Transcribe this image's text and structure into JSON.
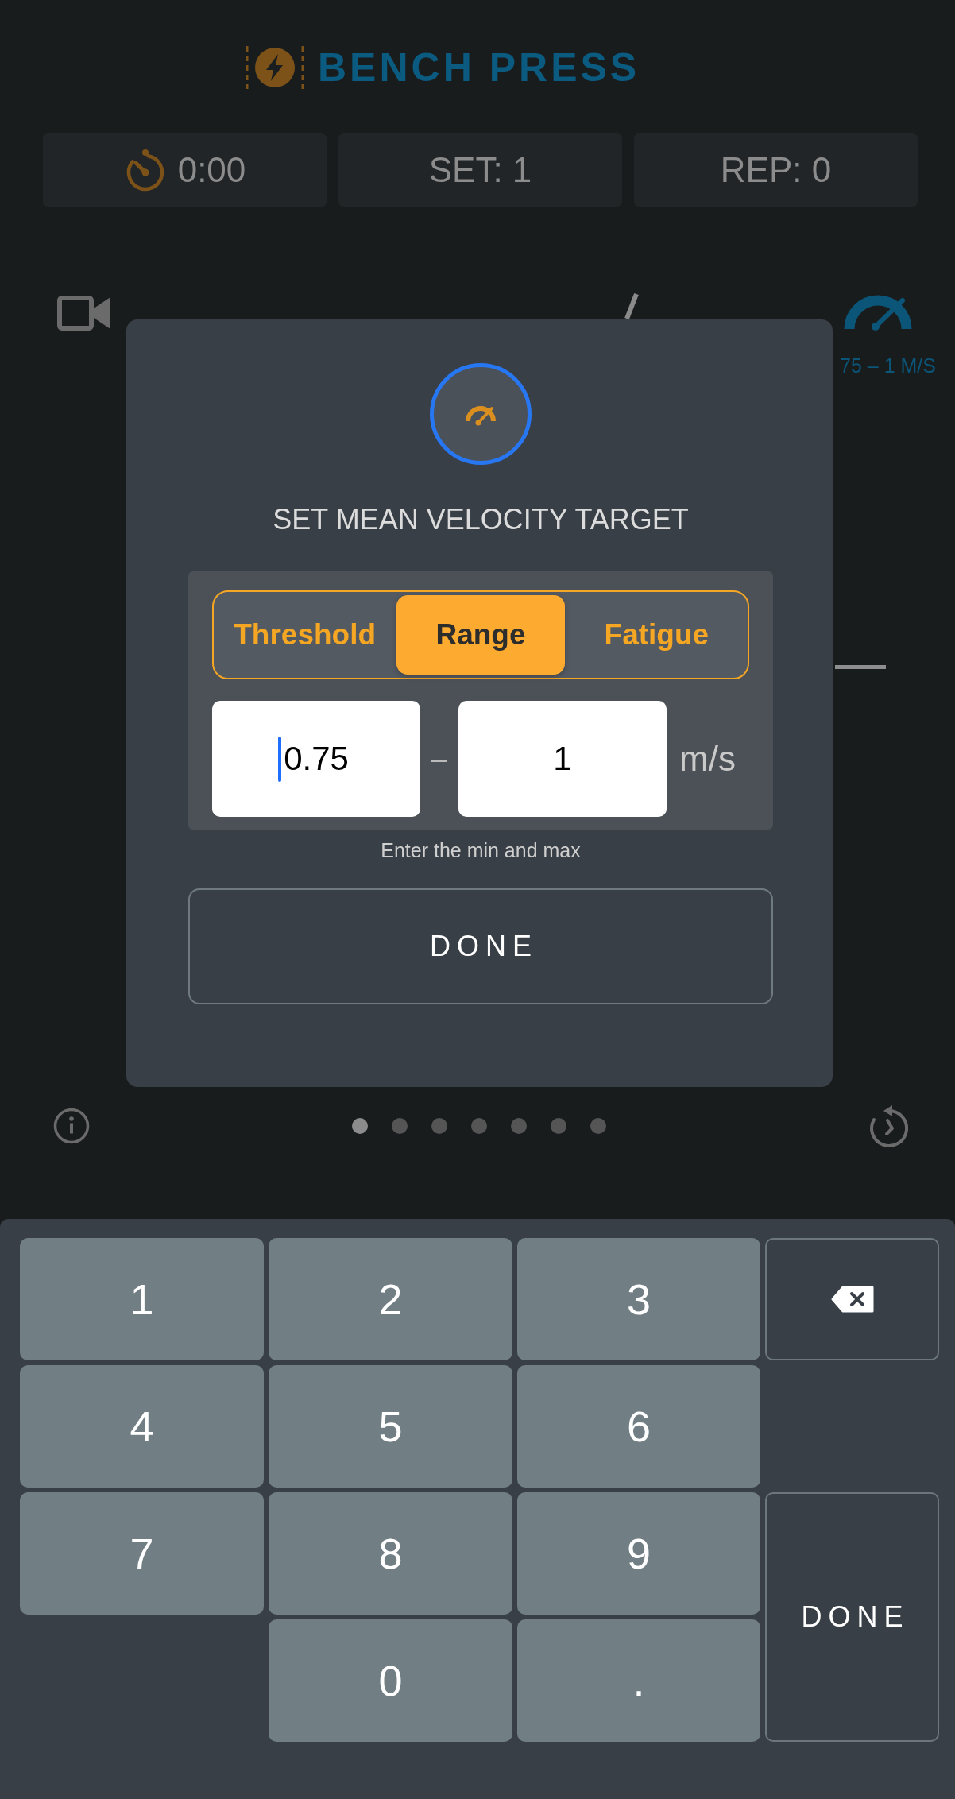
{
  "header": {
    "title": "BENCH PRESS",
    "stats": [
      {
        "kind": "timer",
        "text": "0:00"
      },
      {
        "kind": "counter",
        "text": "SET: 1"
      },
      {
        "kind": "counter",
        "text": "REP: 0"
      }
    ]
  },
  "workout": {
    "velocity_target": "75 – 1 M/S"
  },
  "dialog": {
    "title": "SET MEAN VELOCITY TARGET",
    "modes": [
      {
        "label": "Threshold",
        "selected": false
      },
      {
        "label": "Range",
        "selected": true
      },
      {
        "label": "Fatigue",
        "selected": false
      }
    ],
    "fields": [
      {
        "value": "0.75",
        "focused": true
      },
      {
        "value": "1",
        "focused": false
      }
    ],
    "separator": "–",
    "unit": "m/s",
    "hint": "Enter the min and max",
    "button": "DONE"
  },
  "pager": {
    "dots": [
      {
        "selected": true
      },
      {
        "selected": false
      },
      {
        "selected": false
      },
      {
        "selected": false
      },
      {
        "selected": false
      },
      {
        "selected": false
      },
      {
        "selected": false
      }
    ]
  },
  "keypad": {
    "keys": [
      {
        "kind": "digit",
        "label": "1"
      },
      {
        "kind": "digit",
        "label": "2"
      },
      {
        "kind": "digit",
        "label": "3"
      },
      {
        "kind": "backspace"
      },
      {
        "kind": "digit",
        "label": "4"
      },
      {
        "kind": "digit",
        "label": "5"
      },
      {
        "kind": "digit",
        "label": "6"
      },
      {
        "kind": "digit",
        "label": "7"
      },
      {
        "kind": "digit",
        "label": "8"
      },
      {
        "kind": "digit",
        "label": "9"
      },
      {
        "kind": "done",
        "label": "DONE"
      },
      {
        "kind": "digit",
        "label": "0"
      },
      {
        "kind": "decimal",
        "label": "."
      }
    ]
  }
}
